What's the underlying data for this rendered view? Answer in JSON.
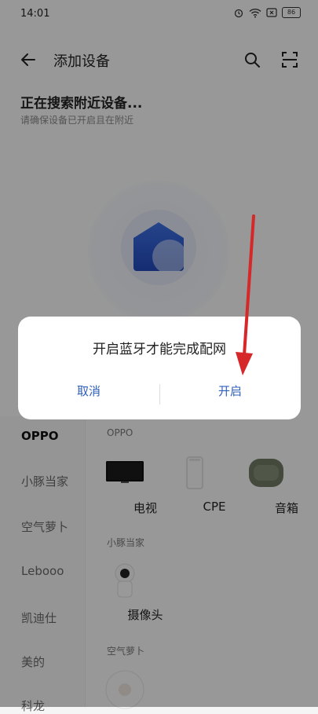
{
  "status_bar": {
    "time": "14:01",
    "battery": "86"
  },
  "header": {
    "title": "添加设备"
  },
  "search": {
    "title": "正在搜索附近设备...",
    "subtitle": "请确保设备已开启且在附近"
  },
  "dialog": {
    "message": "开启蓝牙才能完成配网",
    "cancel_label": "取消",
    "confirm_label": "开启"
  },
  "sidebar": {
    "items": [
      {
        "label": "OPPO",
        "active": true
      },
      {
        "label": "小豚当家"
      },
      {
        "label": "空气萝卜"
      },
      {
        "label": "Lebooo"
      },
      {
        "label": "凯迪仕"
      },
      {
        "label": "美的"
      },
      {
        "label": "科龙"
      }
    ]
  },
  "content": {
    "groups": [
      {
        "title": "OPPO",
        "devices": [
          {
            "label": "电视",
            "icon": "tv-icon"
          },
          {
            "label": "CPE",
            "icon": "cpe-router-icon"
          },
          {
            "label": "音箱",
            "icon": "speaker-icon"
          }
        ]
      },
      {
        "title": "小豚当家",
        "devices": [
          {
            "label": "摄像头",
            "icon": "camera-icon"
          }
        ]
      },
      {
        "title": "空气萝卜",
        "devices": [
          {
            "label": "",
            "icon": "air-purifier-icon"
          }
        ]
      }
    ]
  },
  "colors": {
    "accent": "#2d5fb8",
    "arrow": "#d62828"
  }
}
